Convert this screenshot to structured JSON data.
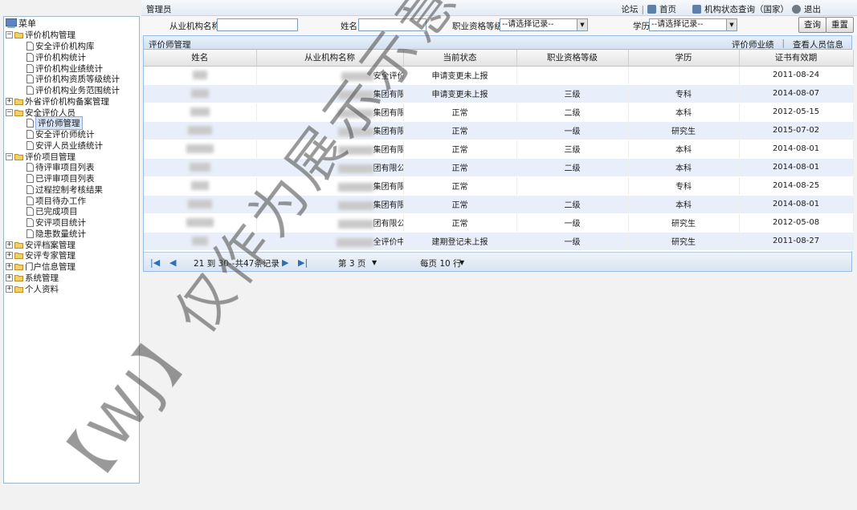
{
  "topbar": {
    "user": "管理员",
    "links": [
      "论坛",
      "首页",
      "机构状态查询（国家）",
      "退出"
    ]
  },
  "search": {
    "org_label": "从业机构名称",
    "name_label": "姓名",
    "qual_label": "职业资格等级",
    "qual_value": "--请选择记录--",
    "edu_label": "学历",
    "edu_value": "--请选择记录--",
    "query_btn": "查询",
    "reset_btn": "重置"
  },
  "sidebar": {
    "root": "菜单",
    "g1": "评价机构管理",
    "g1_items": [
      "安全评价机构库",
      "评价机构统计",
      "评价机构业绩统计",
      "评价机构资质等级统计",
      "评价机构业务范围统计"
    ],
    "g2": "外省评价机构备案管理",
    "g3": "安全评价人员",
    "g3_items": [
      "评价师管理",
      "安全评价师统计",
      "安评人员业绩统计"
    ],
    "g4": "评价项目管理",
    "g4_items": [
      "待评审项目列表",
      "已评审项目列表",
      "过程控制考核结果",
      "项目待办工作",
      "已完成项目",
      "安评项目统计",
      "隐患数量统计"
    ],
    "others": [
      "安评档案管理",
      "安评专家管理",
      "门户信息管理",
      "系统管理",
      "个人资料"
    ]
  },
  "panel": {
    "title": "评价师管理",
    "link1": "评价师业绩",
    "link2": "查看人员信息"
  },
  "table": {
    "headers": [
      "姓名",
      "从业机构名称",
      "当前状态",
      "职业资格等级",
      "学历",
      "证书有效期"
    ],
    "rows": [
      {
        "org": "安全评价中心",
        "status": "申请变更未上报",
        "level": "",
        "edu": "",
        "date": "2011-08-24"
      },
      {
        "org": "集团有限公司",
        "status": "申请变更未上报",
        "level": "三级",
        "edu": "专科",
        "date": "2014-08-07"
      },
      {
        "org": "集团有限公司",
        "status": "正常",
        "level": "二级",
        "edu": "本科",
        "date": "2012-05-15"
      },
      {
        "org": "集团有限公司",
        "status": "正常",
        "level": "一级",
        "edu": "研究生",
        "date": "2015-07-02"
      },
      {
        "org": "集团有限公司",
        "status": "正常",
        "level": "三级",
        "edu": "本科",
        "date": "2014-08-01"
      },
      {
        "org": "团有限公司",
        "status": "正常",
        "level": "二级",
        "edu": "本科",
        "date": "2014-08-01"
      },
      {
        "org": "集团有限公司",
        "status": "正常",
        "level": "",
        "edu": "专科",
        "date": "2014-08-25"
      },
      {
        "org": "集团有限公司",
        "status": "正常",
        "level": "二级",
        "edu": "本科",
        "date": "2014-08-01"
      },
      {
        "org": "团有限公司",
        "status": "正常",
        "level": "一级",
        "edu": "研究生",
        "date": "2012-05-08"
      },
      {
        "org": "全评价中心",
        "status": "建期登记未上报",
        "level": "一级",
        "edu": "研究生",
        "date": "2011-08-27"
      }
    ]
  },
  "pager": {
    "range": "21 到 30--共47条记录",
    "page": "第 3 页",
    "per_page": "每页 10 行"
  },
  "watermark": "【WJ】仅作为展示示意图使用"
}
